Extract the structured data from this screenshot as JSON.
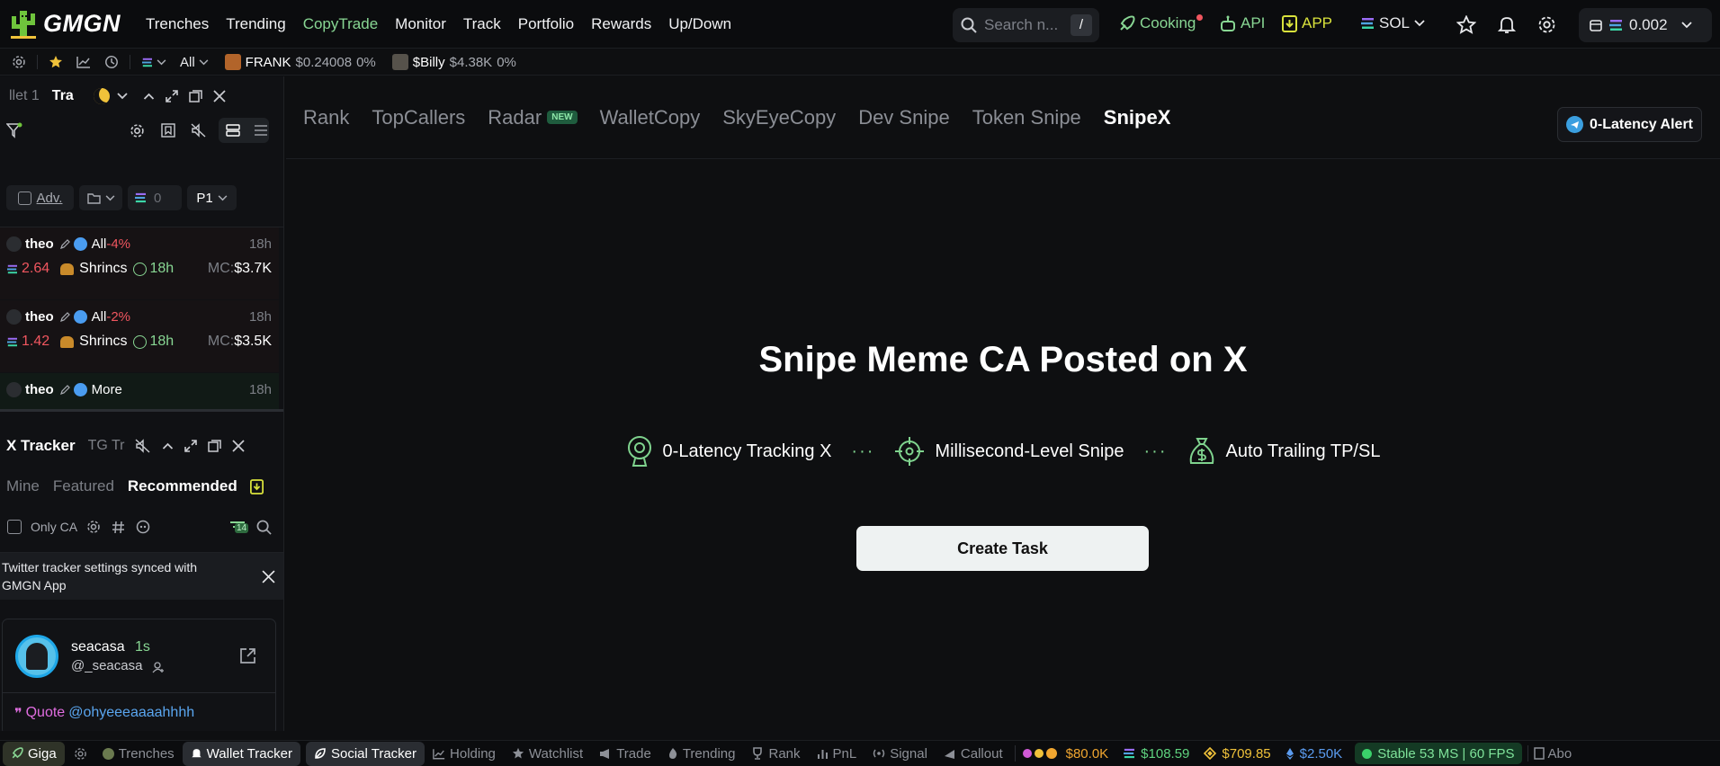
{
  "app": {
    "logo_text": "GMGN"
  },
  "nav": {
    "links": [
      "Trenches",
      "Trending",
      "CopyTrade",
      "Monitor",
      "Track",
      "Portfolio",
      "Rewards",
      "Up/Down"
    ],
    "active": "CopyTrade",
    "search_placeholder": "Search n...",
    "search_shortcut": "/",
    "cooking": "Cooking",
    "api": "API",
    "app": "APP",
    "chain": "SOL",
    "wallet_balance": "0.002"
  },
  "subbar": {
    "filter": "All",
    "tickers": [
      {
        "symbol": "FRANK",
        "price": "$0.24008",
        "change": "0%"
      },
      {
        "symbol": "$Billy",
        "price": "$4.38K",
        "change": "0%"
      }
    ]
  },
  "wallet_panel": {
    "tabs": [
      "llet 1",
      "Tra"
    ],
    "adv_label": "Adv.",
    "amount": "0",
    "preset": "P1",
    "items": [
      {
        "name": "theo",
        "filter": "All",
        "change": "-4%",
        "time": "18h",
        "amount": "2.64",
        "token": "Shrincs",
        "age": "18h",
        "mc_label": "MC:",
        "mc": "$3.7K"
      },
      {
        "name": "theo",
        "filter": "All",
        "change": "-2%",
        "time": "18h",
        "amount": "1.42",
        "token": "Shrincs",
        "age": "18h",
        "mc_label": "MC:",
        "mc": "$3.5K"
      },
      {
        "name": "theo",
        "filter": "More",
        "change": "",
        "time": "18h"
      }
    ]
  },
  "x_tracker": {
    "title": "X Tracker",
    "other_tab": "TG Tr",
    "subtabs": [
      "Mine",
      "Featured",
      "Recommended"
    ],
    "active_subtab": "Recommended",
    "only_ca": "Only CA",
    "count": "14",
    "notice": "Twitter tracker settings synced with GMGN App",
    "tweet": {
      "name": "seacasa",
      "age": "1s",
      "handle": "@_seacasa",
      "quote_label": "Quote",
      "quote_handle": "@ohyeeeaaaahhhh"
    }
  },
  "main": {
    "tabs": [
      {
        "label": "Rank"
      },
      {
        "label": "TopCallers"
      },
      {
        "label": "Radar",
        "badge": "NEW"
      },
      {
        "label": "WalletCopy"
      },
      {
        "label": "SkyEyeCopy"
      },
      {
        "label": "Dev Snipe"
      },
      {
        "label": "Token Snipe"
      },
      {
        "label": "SnipeX"
      }
    ],
    "active_tab": "SnipeX",
    "alert_button": "0-Latency Alert",
    "hero_title": "Snipe Meme CA Posted on X",
    "features": [
      "0-Latency Tracking X",
      "Millisecond-Level Snipe",
      "Auto Trailing TP/SL"
    ],
    "cta": "Create Task"
  },
  "bottombar": {
    "items": [
      {
        "label": "Giga",
        "icon": "rocket-icon"
      },
      {
        "label": "Trenches",
        "icon": "fire-icon"
      },
      {
        "label": "Wallet Tracker",
        "icon": "bell-icon"
      },
      {
        "label": "Social Tracker",
        "icon": "leaf-icon"
      },
      {
        "label": "Holding",
        "icon": "chart-icon"
      },
      {
        "label": "Watchlist",
        "icon": "star-icon"
      },
      {
        "label": "Trade",
        "icon": "megaphone-icon"
      },
      {
        "label": "Trending",
        "icon": "flame-icon"
      },
      {
        "label": "Rank",
        "icon": "trophy-icon"
      },
      {
        "label": "PnL",
        "icon": "bars-icon"
      },
      {
        "label": "Signal",
        "icon": "signal-icon"
      },
      {
        "label": "Callout",
        "icon": "horn-icon"
      }
    ],
    "prices": [
      {
        "value": "$80.0K",
        "color": "#f0a630"
      },
      {
        "value": "$108.59",
        "color": "#5fd37f"
      },
      {
        "value": "$709.85",
        "color": "#f0c23a"
      },
      {
        "value": "$2.50K",
        "color": "#5b9cf0"
      }
    ],
    "status": "Stable 53 MS | 60 FPS",
    "trailing": "Abo"
  },
  "colors": {
    "accent_green": "#88d693",
    "alert_red": "#f0565f",
    "bg": "#0e0f11"
  }
}
